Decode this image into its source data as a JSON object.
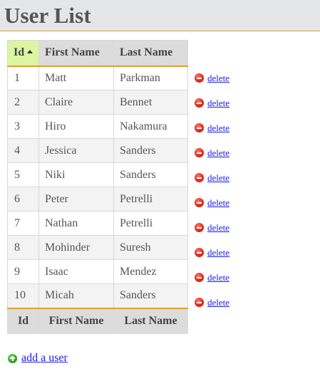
{
  "header": {
    "title": "User List"
  },
  "table": {
    "columns": [
      "Id",
      "First Name",
      "Last Name"
    ],
    "sorted_column": "Id",
    "sort_direction": "ascending",
    "rows": [
      {
        "id": "1",
        "first": "Matt",
        "last": "Parkman"
      },
      {
        "id": "2",
        "first": "Claire",
        "last": "Bennet"
      },
      {
        "id": "3",
        "first": "Hiro",
        "last": "Nakamura"
      },
      {
        "id": "4",
        "first": "Jessica",
        "last": "Sanders"
      },
      {
        "id": "5",
        "first": "Niki",
        "last": "Sanders"
      },
      {
        "id": "6",
        "first": "Peter",
        "last": "Petrelli"
      },
      {
        "id": "7",
        "first": "Nathan",
        "last": "Petrelli"
      },
      {
        "id": "8",
        "first": "Mohinder",
        "last": "Suresh"
      },
      {
        "id": "9",
        "first": "Isaac",
        "last": "Mendez"
      },
      {
        "id": "10",
        "first": "Micah",
        "last": "Sanders"
      }
    ],
    "footer": [
      "Id",
      "First Name",
      "Last Name"
    ]
  },
  "row_actions": {
    "delete_label": "delete",
    "delete_icon": "delete-icon",
    "delete_icon_color": "#e02a1a"
  },
  "footer_actions": {
    "add_label": "add a user",
    "add_icon": "add-icon",
    "add_icon_color": "#2faa22"
  },
  "colors": {
    "header_bg": "#e4e6ea",
    "accent_border": "#e0a030",
    "sorted_header_bg": "#dcf5a0",
    "link": "#1a1aee"
  }
}
